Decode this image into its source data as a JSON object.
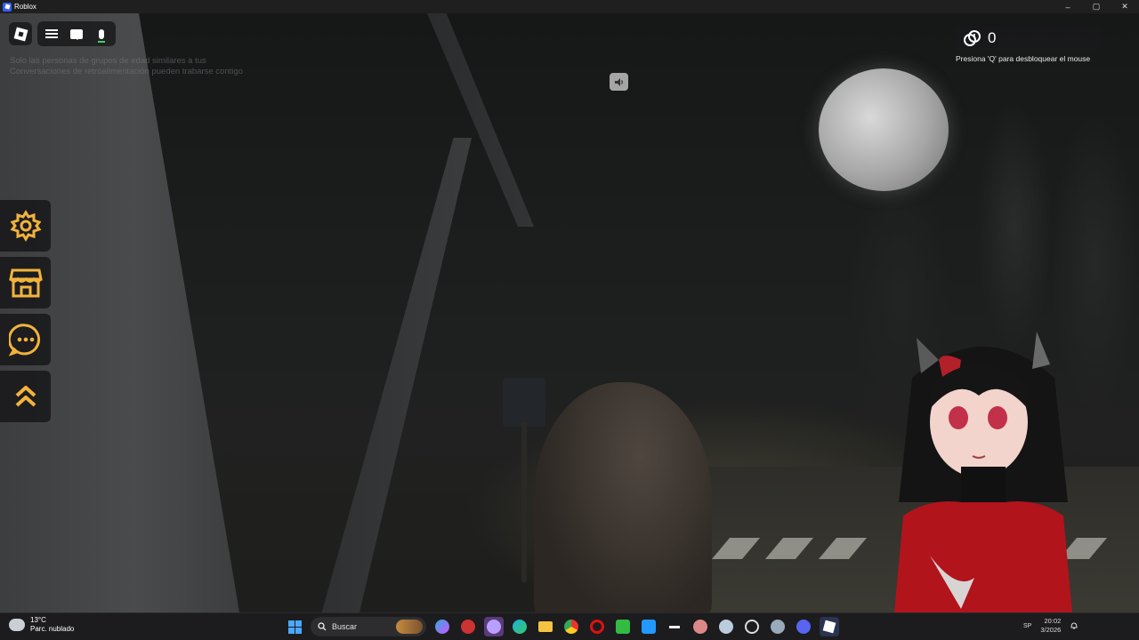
{
  "window": {
    "title": "Roblox",
    "minimize": "–",
    "maximize": "▢",
    "close": "✕"
  },
  "hud": {
    "chat_notice_line1": "Solo las personas de grupos de edad similares a tus",
    "chat_notice_line2": "Conversaciones de retroalimentación pueden trabarse contigo",
    "points_value": "0",
    "mouse_hint": "Presiona 'Q' para desbloquear el mouse"
  },
  "side_menu": [
    "settings-icon",
    "shop-icon",
    "chat-icon",
    "chevron-up-icon"
  ],
  "accent_color": "#f2b33d",
  "taskbar": {
    "weather_temp": "13°C",
    "weather_desc": "Parc. nublado",
    "search_placeholder": "Buscar",
    "lang": "SP",
    "clock_time": "20:02",
    "clock_date": "3/2026"
  }
}
